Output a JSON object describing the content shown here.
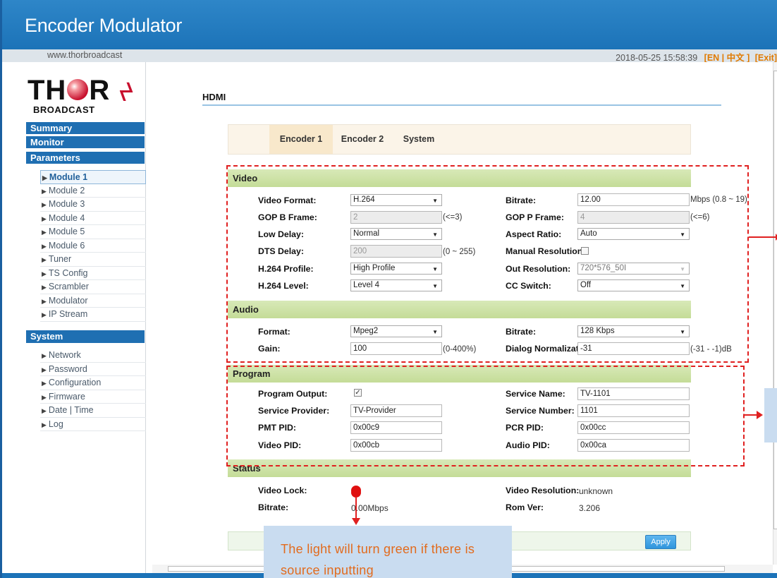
{
  "app": {
    "title": "Encoder Modulator",
    "url": "www.thorbroadcast",
    "datetime": "2018-05-25 15:58:39",
    "lang_links": "[EN | 中文 ]",
    "exit_link": "[Exit]"
  },
  "logo": {
    "brand": "THOR",
    "sub": "BROADCAST"
  },
  "sidebar": {
    "summary": "Summary",
    "monitor": "Monitor",
    "parameters": "Parameters",
    "items": [
      "Module 1",
      "Module 2",
      "Module 3",
      "Module 4",
      "Module 5",
      "Module 6",
      "Tuner",
      "TS Config",
      "Scrambler",
      "Modulator",
      "IP Stream"
    ],
    "system": "System",
    "system_items": [
      "Network",
      "Password",
      "Configuration",
      "Firmware",
      "Date | Time",
      "Log"
    ]
  },
  "page": {
    "title": "HDMI"
  },
  "tabs": [
    "Encoder 1",
    "Encoder 2",
    "System"
  ],
  "video": {
    "section": "Video",
    "video_format": {
      "label": "Video Format:",
      "value": "H.264"
    },
    "bitrate": {
      "label": "Bitrate:",
      "value": "12.00",
      "note": "Mbps (0.8 ~ 19)"
    },
    "gop_b": {
      "label": "GOP B Frame:",
      "value": "2",
      "note": "(<=3)"
    },
    "gop_p": {
      "label": "GOP P Frame:",
      "value": "4",
      "note": "(<=6)"
    },
    "low_delay": {
      "label": "Low Delay:",
      "value": "Normal"
    },
    "aspect": {
      "label": "Aspect Ratio:",
      "value": "Auto"
    },
    "dts_delay": {
      "label": "DTS Delay:",
      "value": "200",
      "note": "(0 ~ 255)"
    },
    "manual_res": {
      "label": "Manual Resolution:"
    },
    "profile": {
      "label": "H.264 Profile:",
      "value": "High Profile"
    },
    "out_res": {
      "label": "Out Resolution:",
      "value": "720*576_50I"
    },
    "level": {
      "label": "H.264 Level:",
      "value": "Level 4"
    },
    "cc": {
      "label": "CC Switch:",
      "value": "Off"
    }
  },
  "audio": {
    "section": "Audio",
    "format": {
      "label": "Format:",
      "value": "Mpeg2"
    },
    "bitrate": {
      "label": "Bitrate:",
      "value": "128 Kbps"
    },
    "gain": {
      "label": "Gain:",
      "value": "100",
      "note": "(0-400%)"
    },
    "dialog": {
      "label": "Dialog Normalization:",
      "value": "-31",
      "note": "(-31 - -1)dB"
    }
  },
  "program": {
    "section": "Program",
    "output": {
      "label": "Program Output:",
      "checked": "✓"
    },
    "service_name": {
      "label": "Service Name:",
      "value": "TV-1101"
    },
    "provider": {
      "label": "Service Provider:",
      "value": "TV-Provider"
    },
    "service_number": {
      "label": "Service Number:",
      "value": "1101"
    },
    "pmt": {
      "label": "PMT PID:",
      "value": "0x00c9"
    },
    "pcr": {
      "label": "PCR PID:",
      "value": "0x00cc"
    },
    "video_pid": {
      "label": "Video PID:",
      "value": "0x00cb"
    },
    "audio_pid": {
      "label": "Audio PID:",
      "value": "0x00ca"
    }
  },
  "status": {
    "section": "Status",
    "video_lock": {
      "label": "Video Lock:"
    },
    "video_res": {
      "label": "Video Resolution:",
      "value": "unknown"
    },
    "bitrate": {
      "label": "Bitrate:",
      "value": "0.00Mbps"
    },
    "rom": {
      "label": "Rom Ver:",
      "value": "3.206"
    }
  },
  "apply": "Apply",
  "annotation": {
    "text": "The light will turn green if there is source inputting"
  },
  "colors": {
    "header": "#1c73b8",
    "section": "#c4dc97",
    "annotation_line": "#e02020",
    "lock_light": "#e01010"
  }
}
